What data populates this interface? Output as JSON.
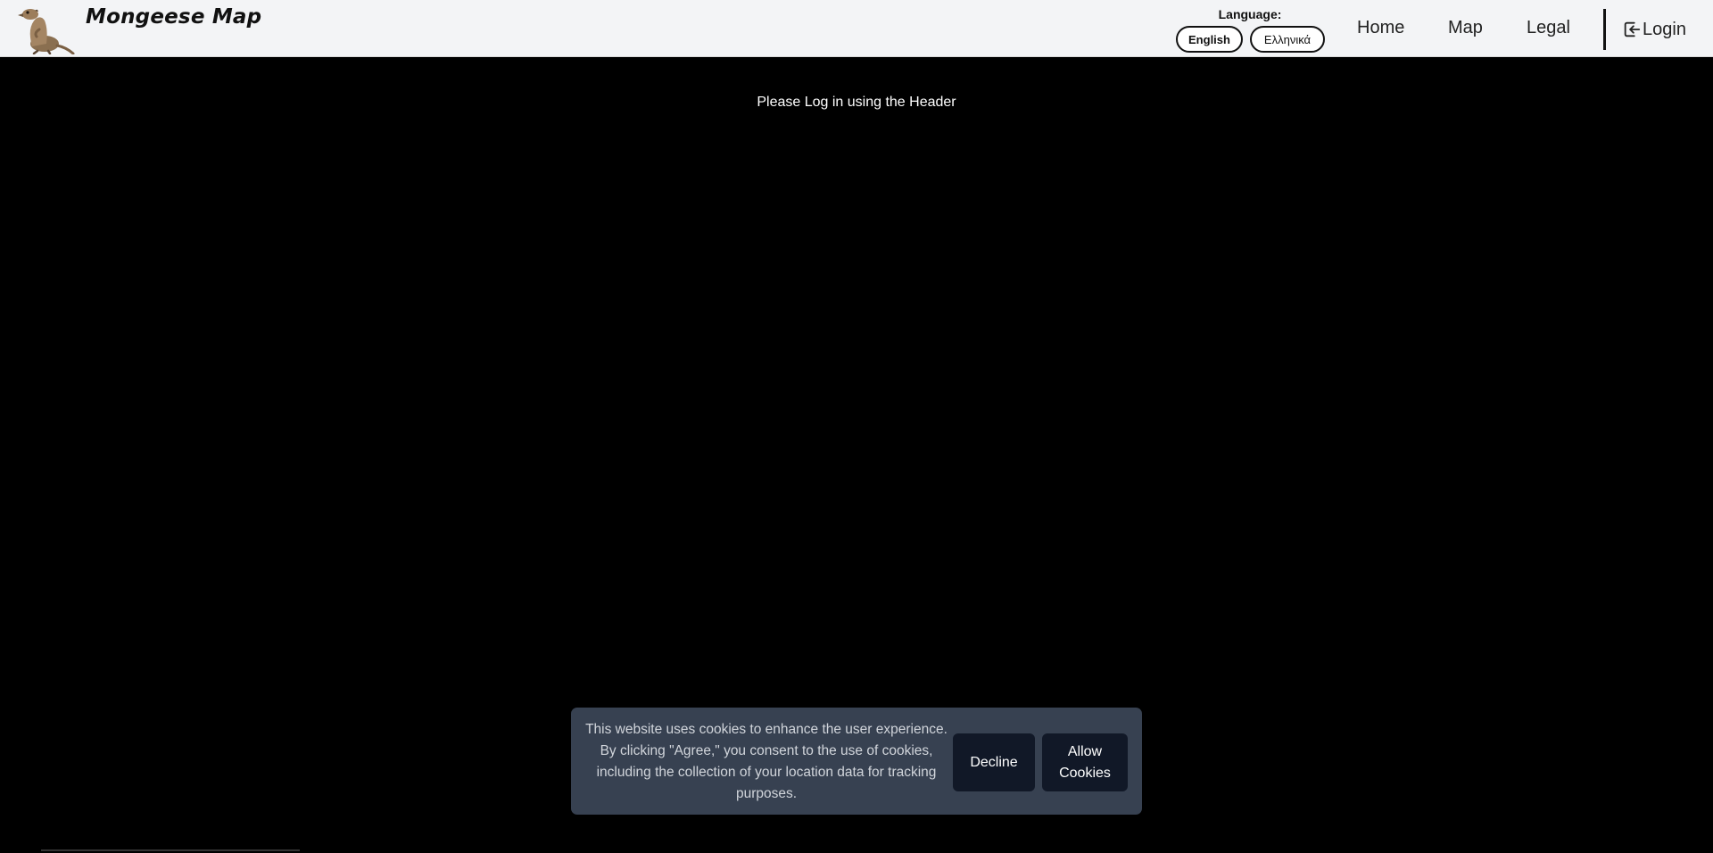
{
  "header": {
    "title": "Mongeese Map",
    "language_label": "Language:",
    "languages": [
      "English",
      "Ελληνικά"
    ],
    "nav": {
      "home": "Home",
      "map": "Map",
      "legal": "Legal"
    },
    "login_label": "Login"
  },
  "main": {
    "message": "Please Log in using the Header"
  },
  "cookie_banner": {
    "text": "This website uses cookies to enhance the user experience. By clicking \"Agree,\" you consent to the use of cookies, including the collection of your location data for tracking purposes.",
    "decline_label": "Decline",
    "allow_label": "Allow Cookies"
  },
  "icons": {
    "logo": "meerkat-logo",
    "login": "login-icon"
  },
  "colors": {
    "header_bg": "#f3f4f6",
    "page_bg": "#000000",
    "banner_bg": "#374151",
    "banner_button_bg": "#111827"
  }
}
